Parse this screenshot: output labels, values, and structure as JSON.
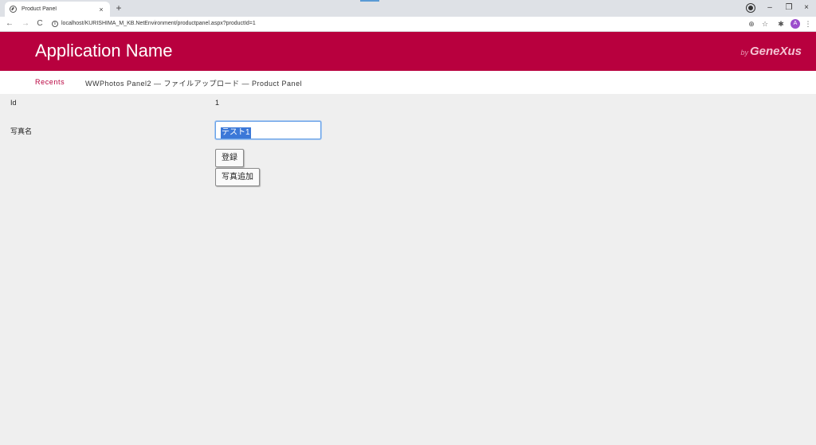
{
  "browser": {
    "tab_title": "Product Panel",
    "tab_close": "×",
    "new_tab": "+",
    "url": "localhost/KURISHIMA_M_KB.NetEnvironment/productpanel.aspx?productId=1",
    "back": "←",
    "forward": "→",
    "reload": "C",
    "info": "i",
    "zoom_icon": "⊕",
    "bookmark_icon": "☆",
    "extensions_icon": "✱",
    "profile_initial": "A",
    "menu_icon": "⋮",
    "minimize": "–",
    "restore": "❐",
    "close": "×"
  },
  "header": {
    "app_name": "Application Name",
    "brand_by": "by",
    "brand_name": "GeneXus"
  },
  "breadcrumb": {
    "recents": "Recents",
    "path": "WWPhotos Panel2 — ファイルアップロード — Product Panel"
  },
  "form": {
    "id_label": "Id",
    "id_value": "1",
    "photo_name_label": "写真名",
    "photo_name_value": "テスト1",
    "register_button": "登録",
    "add_photo_button": "写真追加"
  },
  "colors": {
    "header_bg": "#b8003e",
    "recents_link": "#b8003e",
    "page_bg": "#efefef"
  }
}
